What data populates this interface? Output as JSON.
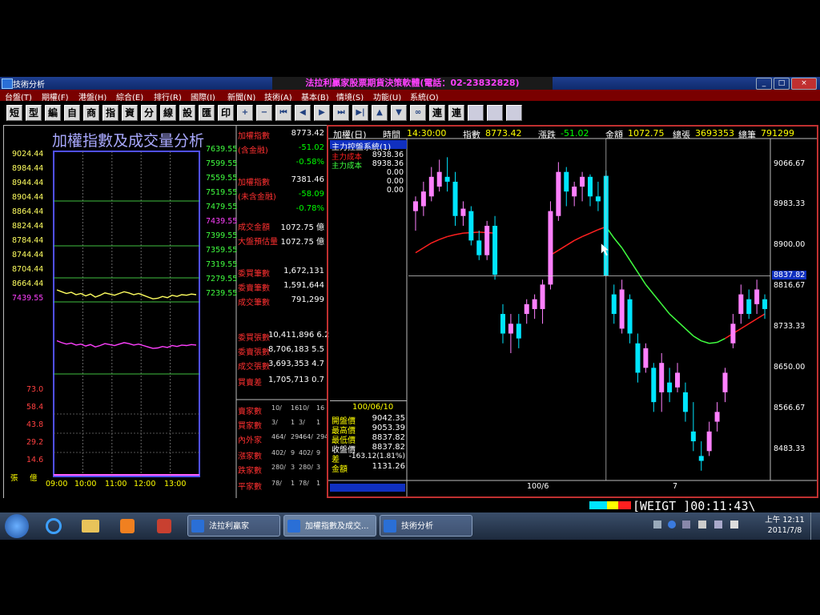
{
  "window": {
    "title": "技術分析",
    "brand": "法拉利贏家股票期貨決策軟體(電話：02-23832828)",
    "controls": [
      "_",
      "□",
      "×"
    ]
  },
  "menu": [
    "台盤(T)",
    "期權(F)",
    "港盤(H)",
    "綜合(E)",
    "排行(R)",
    "國際(I)",
    "新聞(N)",
    "技術(A)",
    "基本(B)",
    "情境(S)",
    "功能(U)",
    "系統(O)"
  ],
  "toolbar": {
    "text_buttons": [
      "短",
      "型",
      "編",
      "自",
      "商",
      "指",
      "資",
      "分",
      "線",
      "設",
      "匯",
      "印"
    ],
    "icon_buttons": [
      "plus-icon",
      "minus-icon",
      "first-icon",
      "prev-icon",
      "next-icon",
      "last-icon",
      "skip-icon",
      "up-icon",
      "down-icon",
      "link-icon"
    ],
    "text_buttons2": [
      "連",
      "連"
    ]
  },
  "intraday": {
    "title": "加權指數及成交量分析",
    "left_axis": [
      "9024.44",
      "8984.44",
      "8944.44",
      "8904.44",
      "8864.44",
      "8824.44",
      "8784.44",
      "8744.44",
      "8704.44",
      "8664.44",
      "7439.55"
    ],
    "right_axis": [
      "7639.55",
      "7599.55",
      "7559.55",
      "7519.55",
      "7479.55",
      "7439.55",
      "7399.55",
      "7359.55",
      "7319.55",
      "7279.55",
      "7239.55"
    ],
    "volume_axis": [
      "73.0",
      "58.4",
      "43.8",
      "29.2",
      "14.6"
    ],
    "volume_unit": [
      "張",
      "億"
    ],
    "time_axis": [
      "09:00",
      "10:00",
      "11:00",
      "12:00",
      "13:00"
    ],
    "index_line": [
      8792,
      8789,
      8786,
      8788,
      8784,
      8786,
      8782,
      8785,
      8780,
      8783,
      8787,
      8785,
      8783,
      8786,
      8789,
      8787,
      8784,
      8786,
      8783,
      8780,
      8777,
      8778,
      8781,
      8779,
      8783,
      8781,
      8784,
      8783,
      8785,
      8784
    ],
    "ex_line": [
      7392,
      7388,
      7385,
      7387,
      7383,
      7385,
      7381,
      7384,
      7379,
      7382,
      7386,
      7384,
      7382,
      7385,
      7388,
      7386,
      7383,
      7385,
      7382,
      7379,
      7376,
      7377,
      7380,
      7378,
      7382,
      7380,
      7383,
      7382,
      7384,
      7383
    ],
    "quote": [
      {
        "label": "加權指數",
        "value": "8773.42"
      },
      {
        "label": "(含金融)",
        "value": "-51.02"
      },
      {
        "label": "",
        "value": "-0.58%"
      },
      {
        "label": "加權指數",
        "value": "7381.46"
      },
      {
        "label": "(未含金融)",
        "value": "-58.09"
      },
      {
        "label": "",
        "value": "-0.78%"
      },
      {
        "label": "成交金額",
        "value": "1072.75 億"
      },
      {
        "label": "大盤預估量",
        "value": "1072.75 億"
      },
      {
        "label": "委買筆數",
        "value": "1,672,131"
      },
      {
        "label": "委賣筆數",
        "value": "1,591,644"
      },
      {
        "label": "成交筆數",
        "value": "791,299"
      },
      {
        "label": "委買張數",
        "value": "10,411,896 6.2"
      },
      {
        "label": "委賣張數",
        "value": "8,706,183 5.5"
      },
      {
        "label": "成交張數",
        "value": "3,693,353 4.7"
      },
      {
        "label": "買賣差",
        "value": "1,705,713 0.7"
      }
    ],
    "breadth": [
      {
        "label": "賣家數",
        "cells": [
          "10/",
          "16",
          "10/",
          "16"
        ]
      },
      {
        "label": "買家數",
        "cells": [
          "3/",
          "1",
          "3/",
          "1"
        ]
      },
      {
        "label": "內外家",
        "cells": [
          "464/",
          "294",
          "464/",
          "294"
        ]
      },
      {
        "label": "漲家數",
        "cells": [
          "402/",
          "9",
          "402/",
          "9"
        ]
      },
      {
        "label": "跌家數",
        "cells": [
          "280/",
          "3",
          "280/",
          "3"
        ]
      },
      {
        "label": "平家數",
        "cells": [
          "78/",
          "1",
          "78/",
          "1"
        ]
      }
    ]
  },
  "kchart": {
    "header": {
      "name": "加權(日)",
      "time_label": "時間",
      "time": "14:30:00",
      "index_label": "指數",
      "index": "8773.42",
      "change_label": "漲跌",
      "change": "-51.02",
      "amount_label": "金額",
      "amount": "1072.75",
      "total_shares_label": "總張",
      "total_shares": "3693353",
      "total_trades_label": "總筆",
      "total_trades": "791299"
    },
    "indicator": "主力控盤系統(1)",
    "indicator_lines": [
      {
        "label": "主力成本",
        "value": "8938.36"
      },
      {
        "label": "主力成本",
        "value": "8938.36"
      },
      {
        "label": "",
        "value": "0.00"
      },
      {
        "label": "",
        "value": "0.00"
      },
      {
        "label": "",
        "value": "0.00"
      }
    ],
    "price_axis": [
      "9066.67",
      "8983.33",
      "8900.00",
      "8816.67",
      "8733.33",
      "8650.00",
      "8566.67",
      "8483.33"
    ],
    "cursor_price": "8837.82",
    "x_labels": [
      "100/6",
      "7"
    ],
    "ohlc": {
      "date": "100/06/10",
      "rows": [
        {
          "label": "開盤價",
          "value": "9042.35"
        },
        {
          "label": "最高價",
          "value": "9053.39"
        },
        {
          "label": "最低價",
          "value": "8837.82"
        },
        {
          "label": "收盤價",
          "value": "8837.82"
        },
        {
          "label": "差",
          "value": "-163.12(1.81%)"
        },
        {
          "label": "金額",
          "value": "1131.26"
        }
      ]
    },
    "candles": [
      {
        "o": 8970,
        "h": 9000,
        "l": 8930,
        "c": 8990
      },
      {
        "o": 8980,
        "h": 9030,
        "l": 8960,
        "c": 9010
      },
      {
        "o": 9000,
        "h": 9060,
        "l": 8990,
        "c": 9040
      },
      {
        "o": 9020,
        "h": 9075,
        "l": 9010,
        "c": 9050
      },
      {
        "o": 9040,
        "h": 9080,
        "l": 9010,
        "c": 9030
      },
      {
        "o": 9030,
        "h": 9050,
        "l": 8940,
        "c": 8960
      },
      {
        "o": 8960,
        "h": 8990,
        "l": 8940,
        "c": 8975
      },
      {
        "o": 8970,
        "h": 8980,
        "l": 8900,
        "c": 8910
      },
      {
        "o": 8910,
        "h": 8930,
        "l": 8870,
        "c": 8880
      },
      {
        "o": 8880,
        "h": 8950,
        "l": 8870,
        "c": 8940
      },
      {
        "o": 8940,
        "h": 8960,
        "l": 8830,
        "c": 8840
      },
      {
        "o": 8760,
        "h": 8780,
        "l": 8700,
        "c": 8720
      },
      {
        "o": 8720,
        "h": 8760,
        "l": 8680,
        "c": 8740
      },
      {
        "o": 8740,
        "h": 8760,
        "l": 8690,
        "c": 8710
      },
      {
        "o": 8760,
        "h": 8790,
        "l": 8740,
        "c": 8780
      },
      {
        "o": 8770,
        "h": 8800,
        "l": 8750,
        "c": 8790
      },
      {
        "o": 8770,
        "h": 8830,
        "l": 8740,
        "c": 8820
      },
      {
        "o": 8820,
        "h": 8990,
        "l": 8810,
        "c": 8970
      },
      {
        "o": 8960,
        "h": 9070,
        "l": 8950,
        "c": 9050
      },
      {
        "o": 9050,
        "h": 9060,
        "l": 8980,
        "c": 9010
      },
      {
        "o": 9000,
        "h": 9030,
        "l": 8980,
        "c": 9020
      },
      {
        "o": 9020,
        "h": 9050,
        "l": 8990,
        "c": 9040
      },
      {
        "o": 9040,
        "h": 9045,
        "l": 8980,
        "c": 9000
      },
      {
        "o": 9000,
        "h": 9030,
        "l": 8970,
        "c": 8990
      },
      {
        "o": 9042,
        "h": 9053,
        "l": 8838,
        "c": 8838
      },
      {
        "o": 8800,
        "h": 8820,
        "l": 8740,
        "c": 8760
      },
      {
        "o": 8730,
        "h": 8830,
        "l": 8720,
        "c": 8810
      },
      {
        "o": 8790,
        "h": 8800,
        "l": 8700,
        "c": 8720
      },
      {
        "o": 8700,
        "h": 8720,
        "l": 8620,
        "c": 8640
      },
      {
        "o": 8650,
        "h": 8700,
        "l": 8640,
        "c": 8690
      },
      {
        "o": 8650,
        "h": 8660,
        "l": 8560,
        "c": 8580
      },
      {
        "o": 8600,
        "h": 8680,
        "l": 8560,
        "c": 8660
      },
      {
        "o": 8620,
        "h": 8650,
        "l": 8580,
        "c": 8600
      },
      {
        "o": 8610,
        "h": 8660,
        "l": 8600,
        "c": 8640
      },
      {
        "o": 8600,
        "h": 8620,
        "l": 8540,
        "c": 8560
      },
      {
        "o": 8520,
        "h": 8580,
        "l": 8480,
        "c": 8500
      },
      {
        "o": 8470,
        "h": 8500,
        "l": 8440,
        "c": 8460
      },
      {
        "o": 8480,
        "h": 8540,
        "l": 8470,
        "c": 8520
      },
      {
        "o": 8540,
        "h": 8580,
        "l": 8520,
        "c": 8560
      },
      {
        "o": 8600,
        "h": 8650,
        "l": 8580,
        "c": 8640
      },
      {
        "o": 8700,
        "h": 8760,
        "l": 8690,
        "c": 8740
      },
      {
        "o": 8760,
        "h": 8820,
        "l": 8740,
        "c": 8800
      },
      {
        "o": 8790,
        "h": 8810,
        "l": 8750,
        "c": 8760
      },
      {
        "o": 8780,
        "h": 8830,
        "l": 8760,
        "c": 8810
      },
      {
        "o": 8790,
        "h": 8800,
        "l": 8750,
        "c": 8770
      }
    ],
    "cost_line": [
      8885,
      8895,
      8905,
      8912,
      8918,
      8922,
      8925,
      8926,
      8927,
      8926,
      8925,
      null,
      null,
      null,
      null,
      null,
      null,
      8880,
      8890,
      8900,
      8910,
      8918,
      8925,
      8932,
      8938,
      8915,
      8895,
      8870,
      8845,
      8820,
      8800,
      8780,
      8760,
      8745,
      8730,
      8715,
      8705,
      8700,
      8702,
      8710,
      8720,
      8730,
      8740,
      8750,
      8760
    ],
    "colors": {
      "up": "#ff80ff",
      "down": "#00e5ff",
      "cost_red": "#ff2020",
      "cost_green": "#40ff40"
    }
  },
  "status": {
    "clock": "[WEIGT_]00:11:43\\"
  },
  "taskbar": {
    "tasks": [
      "法拉利贏家",
      "加權指數及成交...",
      "技術分析"
    ],
    "time": "上午 12:11",
    "date": "2011/7/8"
  }
}
